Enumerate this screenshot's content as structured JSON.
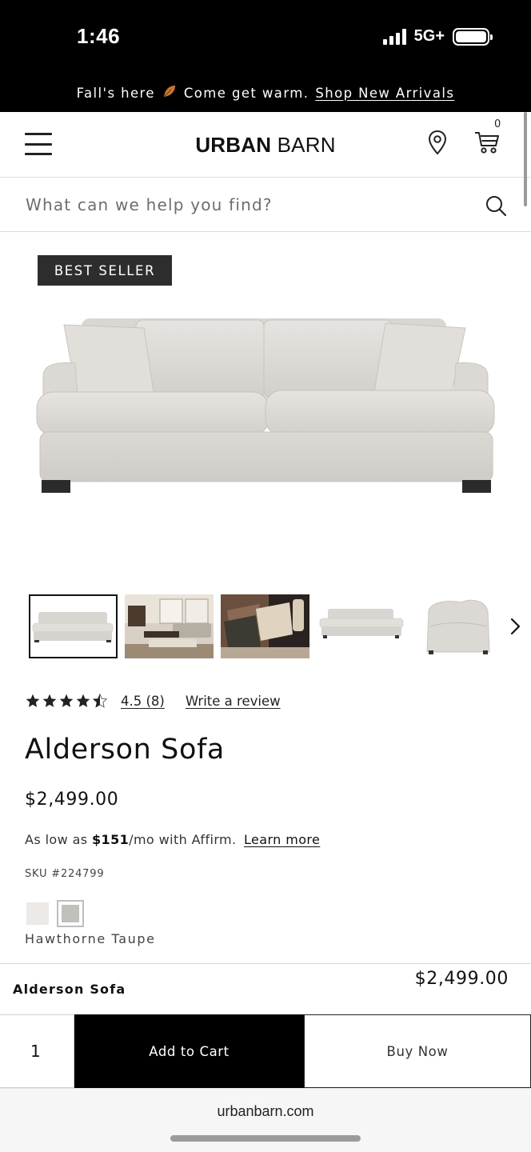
{
  "status_bar": {
    "time": "1:46",
    "network": "5G+"
  },
  "promo": {
    "text": "Fall's here",
    "leaf_icon": "leaf-icon",
    "text2": "Come get warm.",
    "link": "Shop New Arrivals"
  },
  "header": {
    "logo_urban": "URBAN",
    "logo_barn": "BARN",
    "cart_count": "0"
  },
  "search": {
    "placeholder": "What can we help you find?"
  },
  "product": {
    "badge": "BEST SELLER",
    "rating_text": "4.5 (8)",
    "rating_value": 4.5,
    "write_review": "Write a review",
    "title": "Alderson Sofa",
    "price": "$2,499.00",
    "affirm_prefix": "As low as",
    "affirm_amount": "$151",
    "affirm_suffix": "/mo with Affirm.",
    "affirm_link": "Learn more",
    "sku": "SKU #224799",
    "swatches": [
      {
        "color": "#ece9e6"
      },
      {
        "color": "#c2c0bc",
        "selected": true
      }
    ],
    "swatch_name": "Hawthorne Taupe",
    "thumbnails": [
      {
        "name": "sofa-front-view",
        "selected": true
      },
      {
        "name": "living-room-scene"
      },
      {
        "name": "pillows-closeup"
      },
      {
        "name": "sofa-angle-view"
      },
      {
        "name": "sofa-side-view"
      }
    ]
  },
  "sticky_bar": {
    "name": "Alderson Sofa",
    "price": "$2,499.00",
    "quantity": "1",
    "add_to_cart": "Add to Cart",
    "buy_now": "Buy Now"
  },
  "browser": {
    "url": "urbanbarn.com"
  },
  "colors": {
    "black": "#000000",
    "sofa": "#dddad6",
    "badge_bg": "#2d2d2d"
  }
}
